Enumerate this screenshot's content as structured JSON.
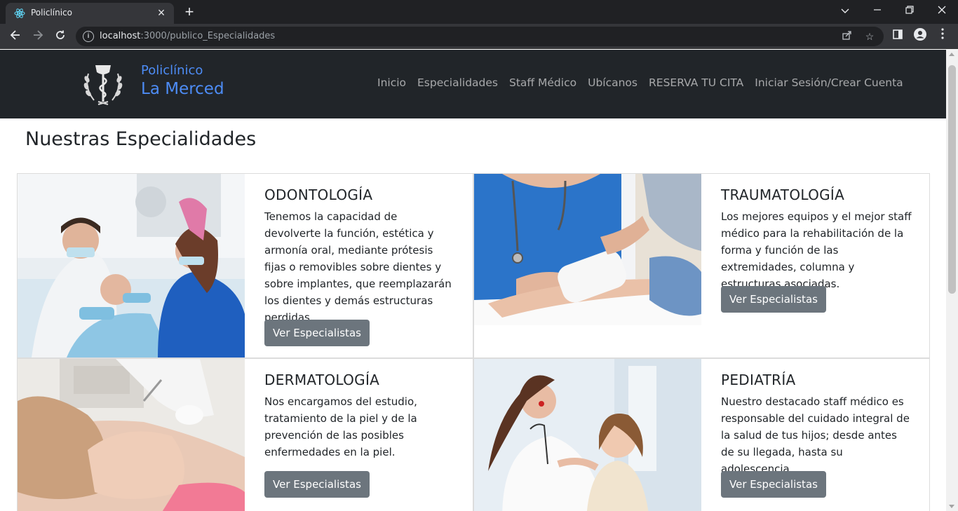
{
  "browser": {
    "tab_title": "Policlínico",
    "url_host": "localhost",
    "url_path": ":3000/publico_Especialidades"
  },
  "site": {
    "brand_top": "Policlínico",
    "brand_bottom": "La Merced",
    "nav": [
      "Inicio",
      "Especialidades",
      "Staff Médico",
      "Ubícanos",
      "RESERVA TU CITA",
      "Iniciar Sesión/Crear Cuenta"
    ]
  },
  "page_title": "Nuestras Especialidades",
  "specialties": [
    {
      "title": "ODONTOLOGÍA",
      "text": "Tenemos la capacidad de devolverte la función, estética y armonía oral, mediante prótesis fijas o removibles sobre dientes y sobre implantes, que reemplazarán los dientes y demás estructuras perdidas.",
      "button": "Ver Especialistas"
    },
    {
      "title": "TRAUMATOLOGÍA",
      "text": "Los mejores equipos y el mejor staff médico para la rehabilitación de la forma y función de las extremidades, columna y estructuras asociadas.",
      "button": "Ver Especialistas"
    },
    {
      "title": "DERMATOLOGÍA",
      "text": "Nos encargamos del estudio, tratamiento de la piel y de la prevención de las posibles enfermedades en la piel.",
      "button": "Ver Especialistas"
    },
    {
      "title": "PEDIATRÍA",
      "text": "Nuestro destacado staff médico es responsable del cuidado integral de la salud de tus hijos; desde antes de su llegada, hasta su adolescencia.",
      "button": "Ver Especialistas"
    }
  ],
  "colors": {
    "navbar": "#212529",
    "brand": "#4d8cf5",
    "button": "#6c757d"
  }
}
